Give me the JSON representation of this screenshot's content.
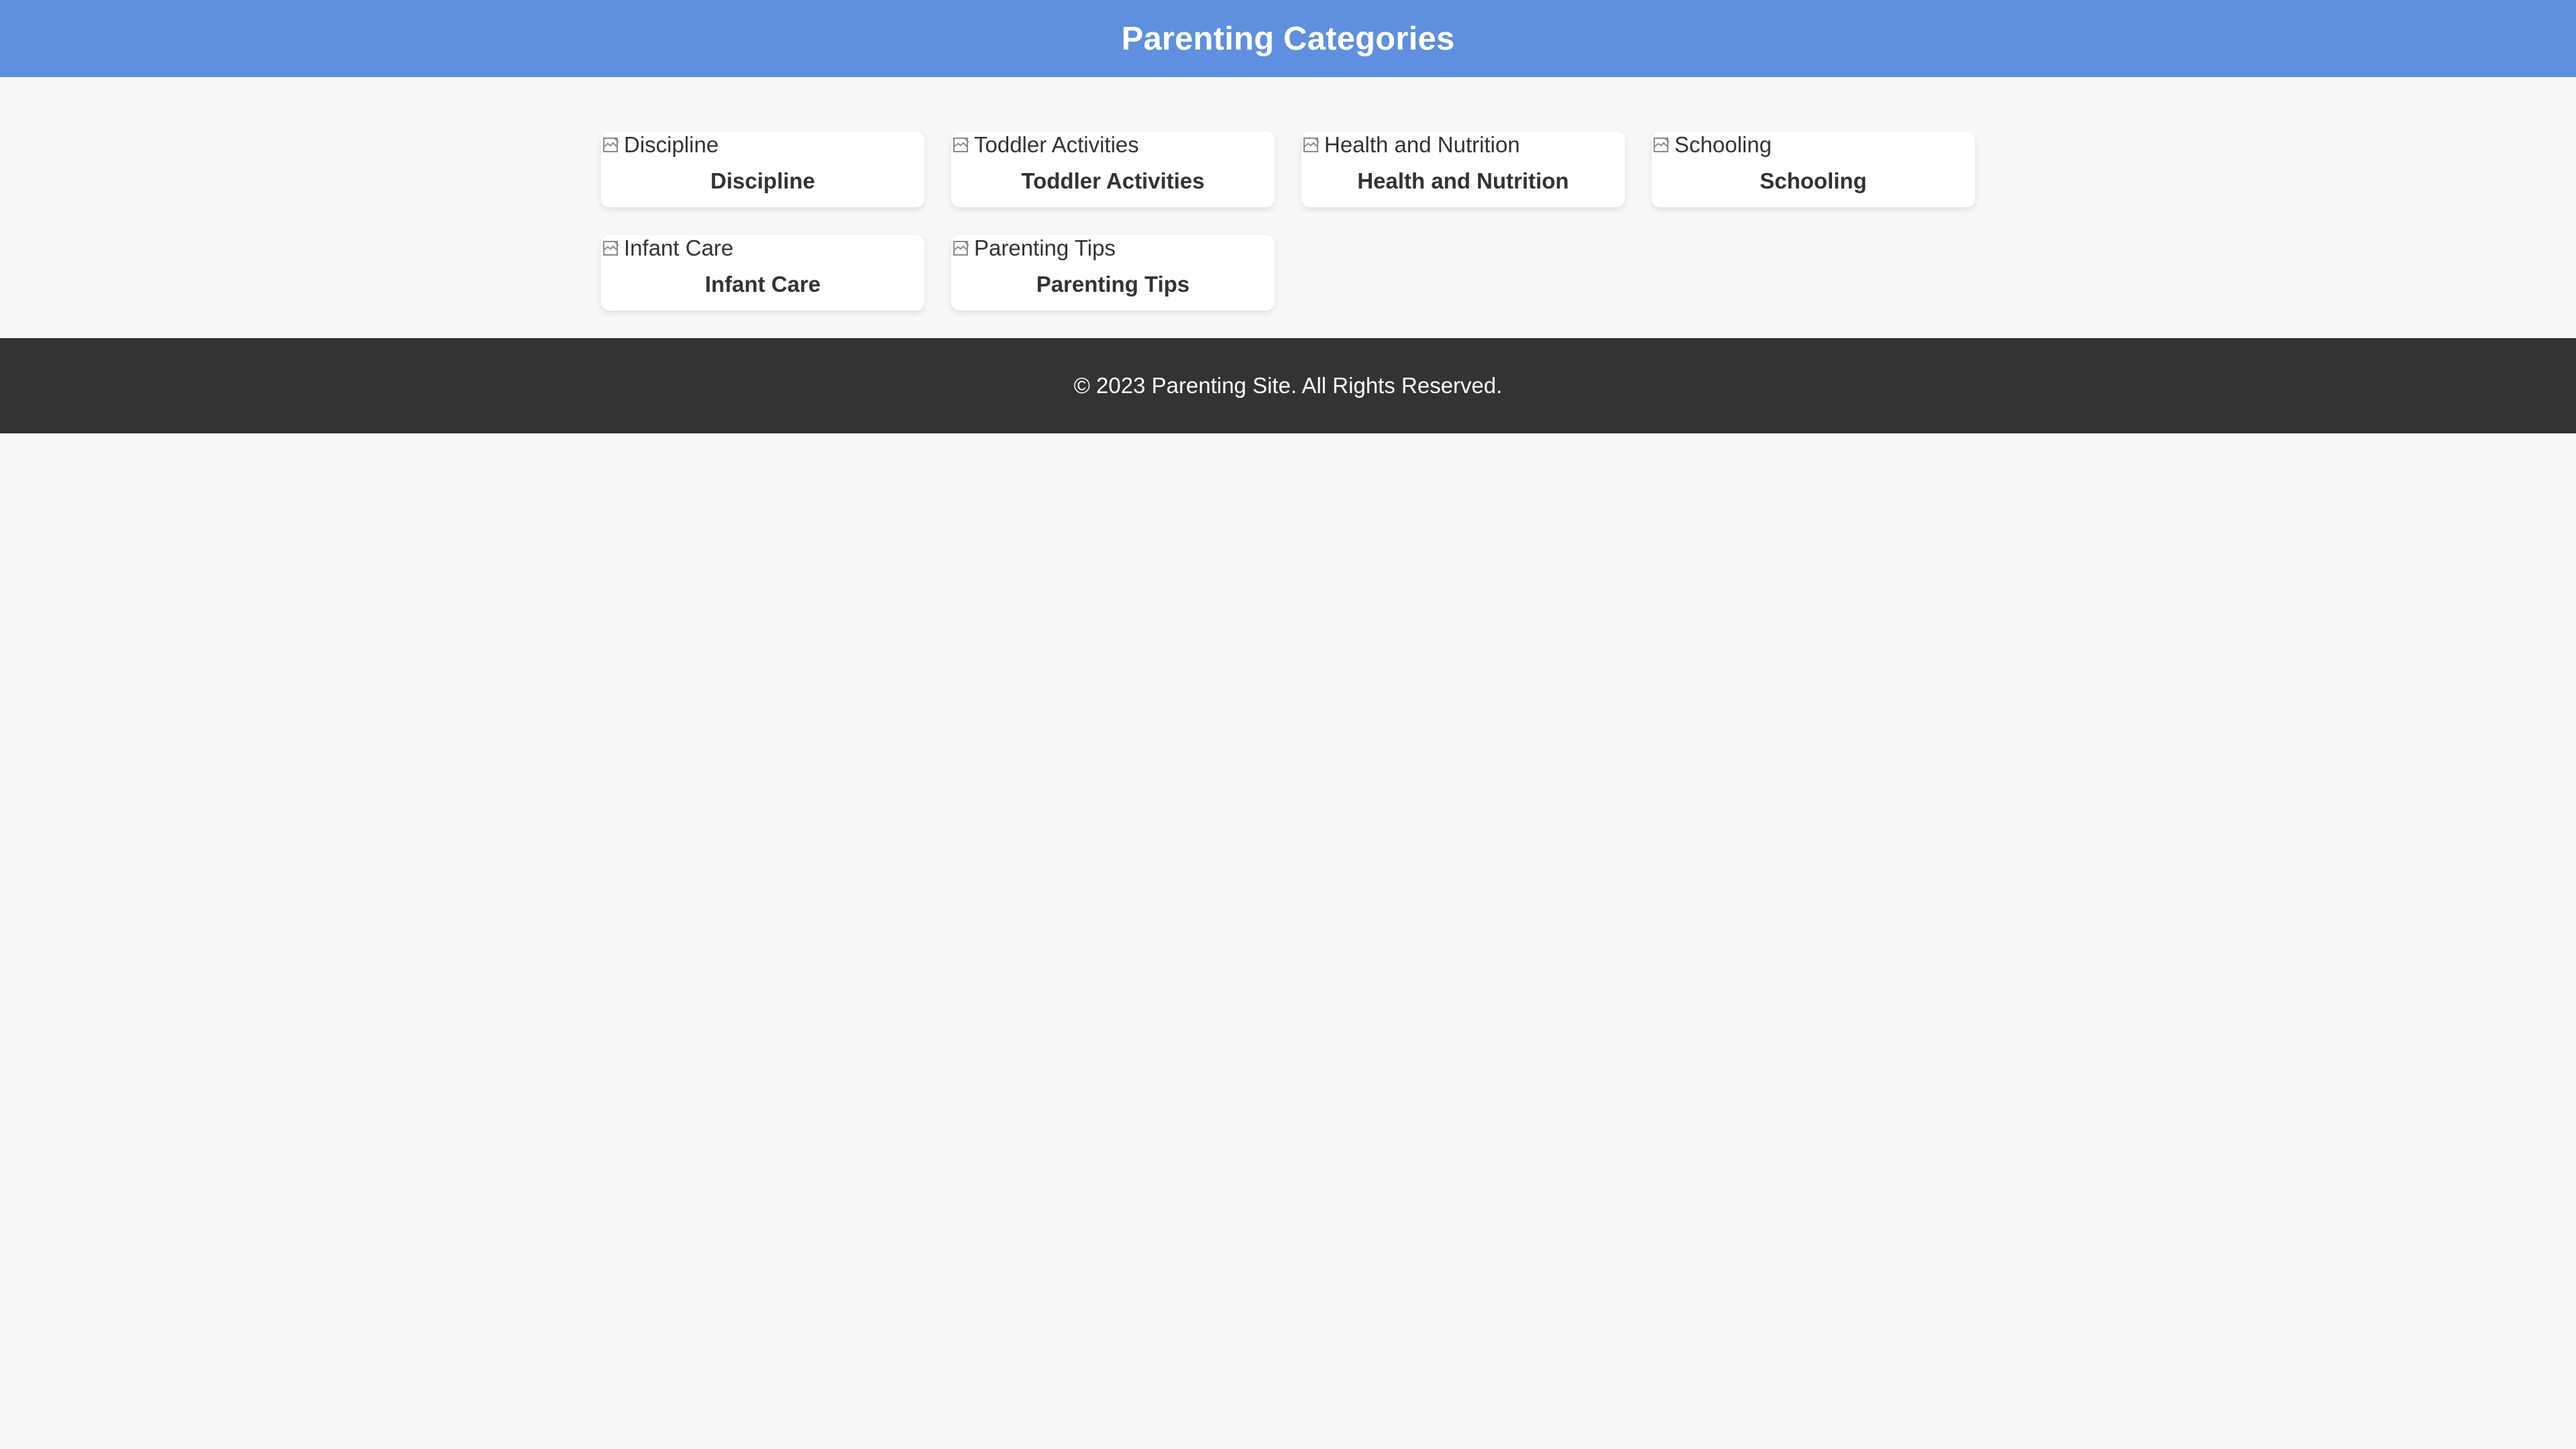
{
  "header": {
    "title": "Parenting Categories"
  },
  "categories": [
    {
      "image_alt": "Discipline",
      "title": "Discipline",
      "icon": "broken-image-icon"
    },
    {
      "image_alt": "Toddler Activities",
      "title": "Toddler Activities",
      "icon": "broken-image-icon"
    },
    {
      "image_alt": "Health and Nutrition",
      "title": "Health and Nutrition",
      "icon": "broken-image-icon"
    },
    {
      "image_alt": "Schooling",
      "title": "Schooling",
      "icon": "broken-image-icon"
    },
    {
      "image_alt": "Infant Care",
      "title": "Infant Care",
      "icon": "broken-image-icon"
    },
    {
      "image_alt": "Parenting Tips",
      "title": "Parenting Tips",
      "icon": "broken-image-icon"
    }
  ],
  "footer": {
    "text": "© 2023 Parenting Site. All Rights Reserved."
  },
  "colors": {
    "header_background": "#5e90df",
    "page_background": "#f8f8f8",
    "card_background": "#ffffff",
    "footer_background": "#333333",
    "text": "#333333",
    "inverse_text": "#ffffff"
  }
}
